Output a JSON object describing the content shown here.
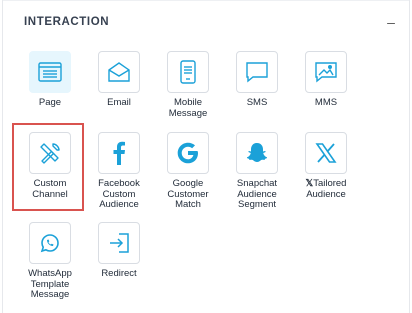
{
  "section": {
    "title": "INTERACTION",
    "collapse_symbol": "–"
  },
  "tiles": [
    {
      "label": "Page",
      "icon": "page-icon",
      "selected": true
    },
    {
      "label": "Email",
      "icon": "email-icon"
    },
    {
      "label": "Mobile\nMessage",
      "icon": "mobile-icon"
    },
    {
      "label": "SMS",
      "icon": "sms-icon"
    },
    {
      "label": "MMS",
      "icon": "mms-icon"
    },
    {
      "label": "Custom\nChannel",
      "icon": "tools-icon",
      "highlighted": true
    },
    {
      "label": "Facebook\nCustom\nAudience",
      "icon": "facebook-icon"
    },
    {
      "label": "Google\nCustomer\nMatch",
      "icon": "google-icon"
    },
    {
      "label": "Snapchat\nAudience\nSegment",
      "icon": "snapchat-icon"
    },
    {
      "label": "Tailored\nAudience",
      "icon": "x-icon",
      "label_prefix_glyph": "𝕏"
    },
    {
      "label": "WhatsApp\nTemplate\nMessage",
      "icon": "whatsapp-icon"
    },
    {
      "label": "Redirect",
      "icon": "redirect-icon"
    }
  ],
  "colors": {
    "accent": "#1ba1d8",
    "highlight": "#d9534f",
    "selected_bg": "#e6f6fd"
  }
}
